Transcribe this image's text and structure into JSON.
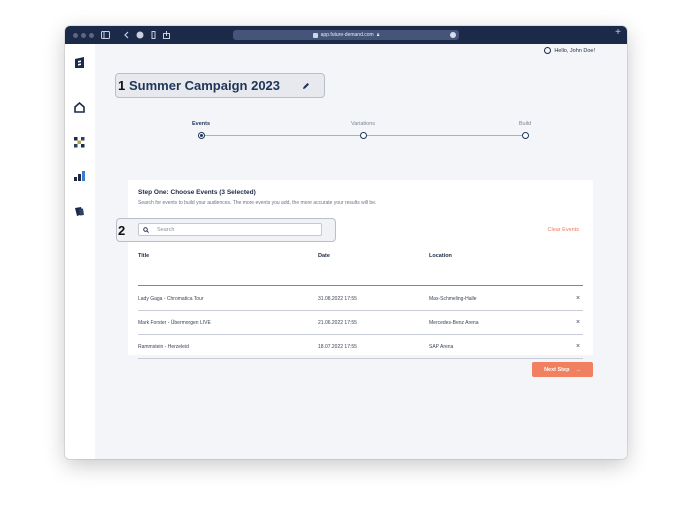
{
  "browser": {
    "url": "app.future-demand.com"
  },
  "user": {
    "greeting": "Hello, John Doe!"
  },
  "campaign": {
    "annotation_1": "1",
    "title": "Summer Campaign 2023"
  },
  "stepper": {
    "steps": [
      {
        "label": "Events",
        "active": true
      },
      {
        "label": "Variations",
        "active": false
      },
      {
        "label": "Build",
        "active": false
      }
    ]
  },
  "events_card": {
    "heading": "Step One: Choose Events (3 Selected)",
    "subheading": "Search for events to build your audiences. The more events you add, the more accurate your results will be.",
    "annotation_2": "2",
    "search_placeholder": "Search",
    "clear_label": "Clear Events",
    "columns": [
      "Title",
      "Date",
      "Location"
    ],
    "rows": [
      {
        "title": "Lady Gaga - Chromatica Tour",
        "date": "31.08.2022 17:55",
        "location": "Max-Schmeling-Halle"
      },
      {
        "title": "Mark Forster - Übermorgen LIVE",
        "date": "21.06.2022 17:55",
        "location": "Mercedes-Benz Arena"
      },
      {
        "title": "Rammstein - Herzeleid",
        "date": "18.07.2022 17:55",
        "location": "SAP Arena"
      }
    ],
    "remove_glyph": "×"
  },
  "next_button": {
    "label": "Next Step",
    "arrow": "→"
  },
  "colors": {
    "navy": "#1c2a4a",
    "accent": "#f08060",
    "background": "#f4f5f8"
  }
}
